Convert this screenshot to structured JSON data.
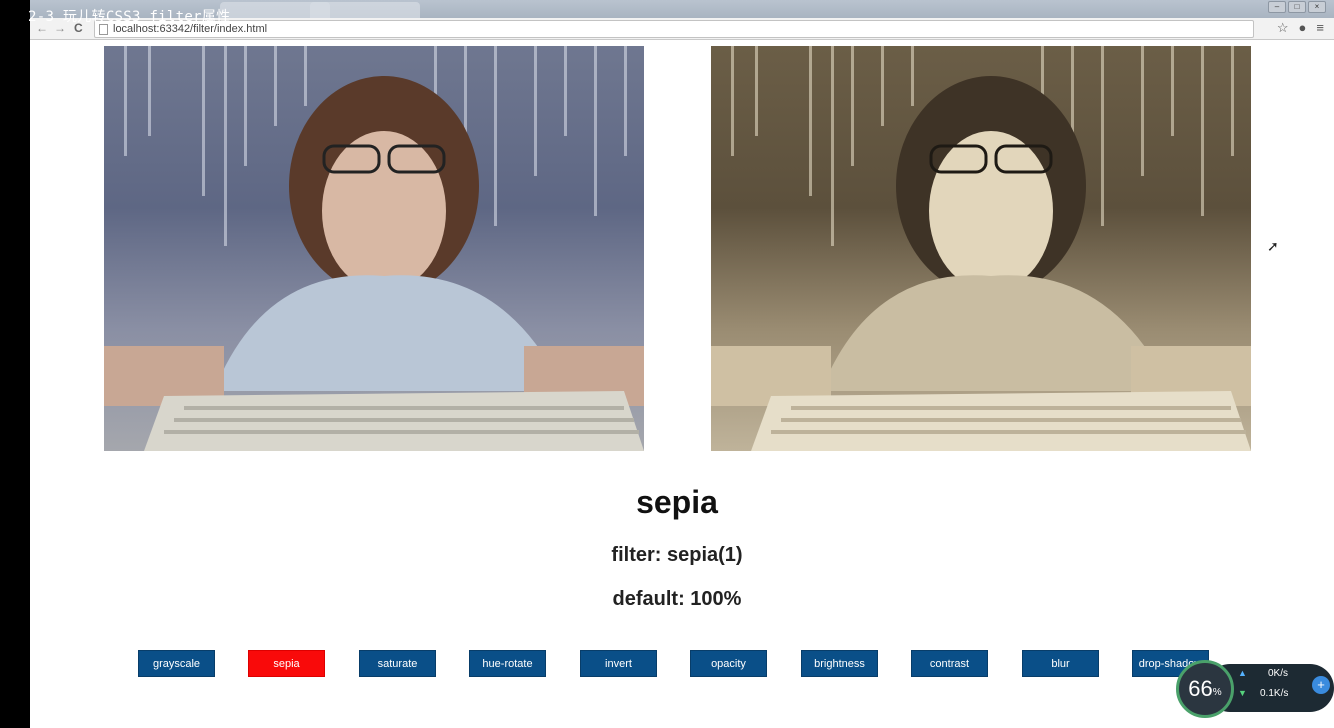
{
  "video": {
    "title": "2-3 玩儿转CSS3 filter属性"
  },
  "browser": {
    "url": "localhost:63342/filter/index.html",
    "nav_back": "←",
    "nav_forward": "→",
    "reload": "C",
    "star": "☆",
    "menu": "≡"
  },
  "filter": {
    "name": "sepia",
    "code": "filter: sepia(1)",
    "default": "default: 100%"
  },
  "buttons": [
    {
      "label": "grayscale",
      "active": false
    },
    {
      "label": "sepia",
      "active": true
    },
    {
      "label": "saturate",
      "active": false
    },
    {
      "label": "hue-rotate",
      "active": false
    },
    {
      "label": "invert",
      "active": false
    },
    {
      "label": "opacity",
      "active": false
    },
    {
      "label": "brightness",
      "active": false
    },
    {
      "label": "contrast",
      "active": false
    },
    {
      "label": "blur",
      "active": false
    },
    {
      "label": "drop-shadow",
      "active": false
    }
  ],
  "speed_widget": {
    "percent": "66",
    "percent_unit": "%",
    "up": "0K/s",
    "down": "0.1K/s"
  },
  "colors": {
    "button_bg": "#0a4f88",
    "button_active": "#f90a0a"
  }
}
